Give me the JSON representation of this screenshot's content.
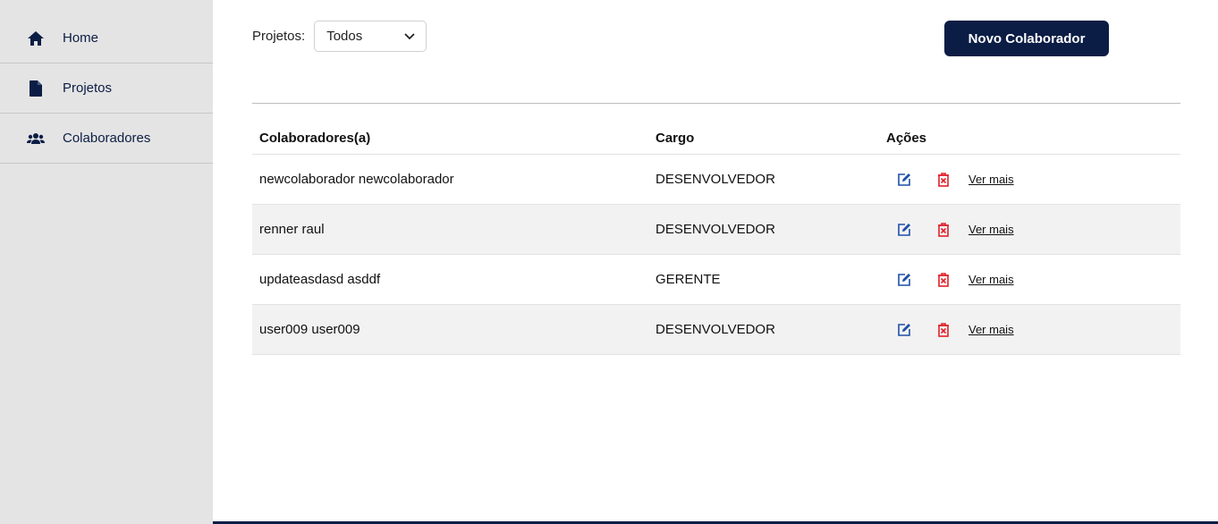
{
  "sidebar": {
    "items": [
      {
        "label": "Home",
        "icon": "home-icon"
      },
      {
        "label": "Projetos",
        "icon": "document-icon"
      },
      {
        "label": "Colaboradores",
        "icon": "users-icon"
      }
    ]
  },
  "filter": {
    "label": "Projetos:",
    "selected": "Todos"
  },
  "actions": {
    "new_button": "Novo Colaborador"
  },
  "table": {
    "headers": {
      "name": "Colaboradores(a)",
      "role": "Cargo",
      "actions": "Ações"
    },
    "rows": [
      {
        "name": "newcolaborador newcolaborador",
        "role": "DESENVOLVEDOR",
        "more": "Ver mais"
      },
      {
        "name": "renner raul",
        "role": "DESENVOLVEDOR",
        "more": "Ver mais"
      },
      {
        "name": "updateasdasd asddf",
        "role": "GERENTE",
        "more": "Ver mais"
      },
      {
        "name": "user009 user009",
        "role": "DESENVOLVEDOR",
        "more": "Ver mais"
      }
    ]
  },
  "colors": {
    "primary": "#0b1d45",
    "edit_icon": "#1f4fa8",
    "delete_icon": "#e0202a",
    "sidebar_bg": "#e4e4e4",
    "row_alt": "#f2f2f2"
  }
}
